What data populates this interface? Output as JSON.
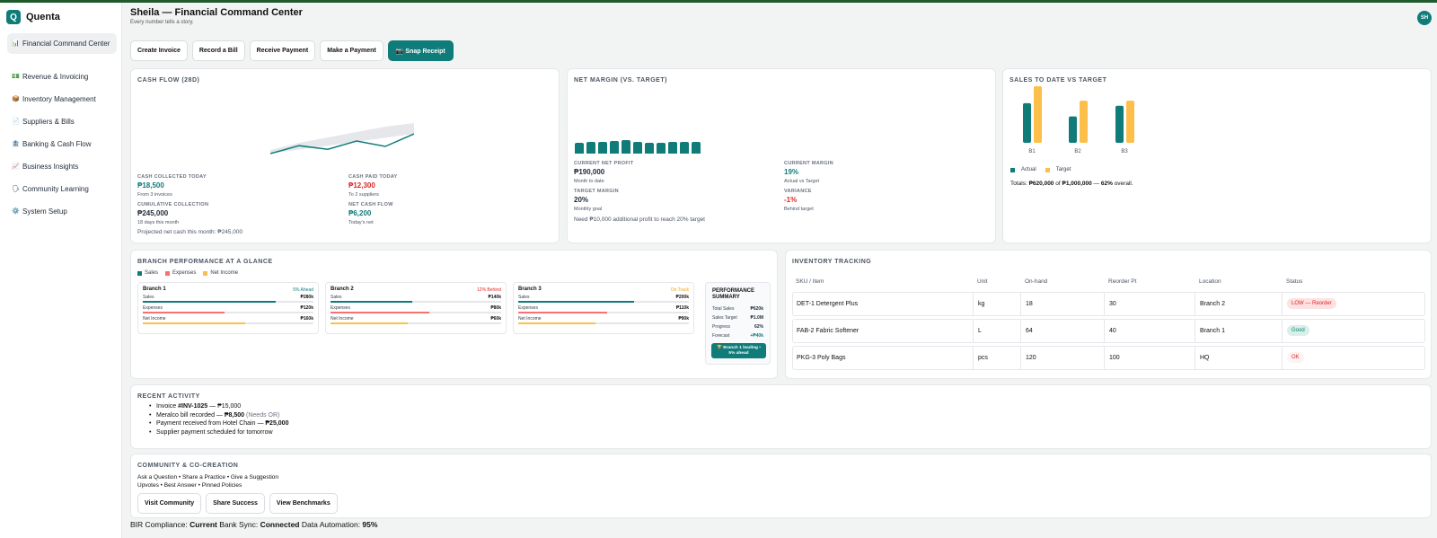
{
  "app": {
    "name": "Quenta",
    "logo_letter": "Q"
  },
  "sidebar": {
    "items": [
      {
        "icon": "📊",
        "label": "Financial Command Center",
        "active": true
      },
      {
        "icon": "💵",
        "label": "Revenue & Invoicing"
      },
      {
        "icon": "📦",
        "label": "Inventory Management"
      },
      {
        "icon": "📄",
        "label": "Suppliers & Bills"
      },
      {
        "icon": "🏦",
        "label": "Banking & Cash Flow"
      },
      {
        "icon": "📈",
        "label": "Business Insights"
      },
      {
        "icon": "🗣",
        "label": "Community Learning"
      },
      {
        "icon": "⚙️",
        "label": "System Setup"
      }
    ]
  },
  "header": {
    "title": "Sheila — Financial Command Center",
    "subtitle": "Every number tells a story.",
    "avatar": "SH"
  },
  "actions": {
    "create_invoice": "Create Invoice",
    "record_bill": "Record a Bill",
    "receive_payment": "Receive Payment",
    "make_payment": "Make a Payment",
    "snap_receipt": "📷 Snap Receipt"
  },
  "cashflow": {
    "title": "Cash Flow (28d)",
    "collected_label": "CASH COLLECTED TODAY",
    "collected_value": "₱18,500",
    "collected_sub": "From 3 invoices",
    "paid_label": "CASH PAID TODAY",
    "paid_value": "₱12,300",
    "paid_sub": "To 2 suppliers",
    "cumulative_label": "CUMULATIVE COLLECTION",
    "cumulative_value": "₱245,000",
    "cumulative_sub": "18 days this month",
    "net_label": "NET CASH FLOW",
    "net_value": "₱6,200",
    "net_sub": "Today's net",
    "projection": "Projected net cash this month: ₱245,000"
  },
  "net_margin": {
    "title": "Net Margin (vs. Target)",
    "bar_values": [
      0.55,
      0.6,
      0.6,
      0.65,
      0.68,
      0.6,
      0.55,
      0.55,
      0.58,
      0.58,
      0.58
    ],
    "profit_label": "CURRENT NET PROFIT",
    "profit_value": "₱190,000",
    "profit_sub": "Month to date",
    "margin_label": "CURRENT MARGIN",
    "margin_value": "19%",
    "margin_sub": "Actual vs Target",
    "target_label": "TARGET MARGIN",
    "target_value": "20%",
    "target_sub": "Monthly goal",
    "variance_label": "VARIANCE",
    "variance_value": "-1%",
    "variance_sub": "Behind target",
    "note": "Need ₱10,000 additional profit to reach 20% target"
  },
  "sales_target": {
    "title": "Sales to Date vs Target",
    "legend_actual": "Actual",
    "legend_target": "Target",
    "totals_prefix": "Totals: ",
    "totals_sales": "₱620,000",
    "totals_of": " of ",
    "totals_target": "₱1,000,000",
    "totals_dash": " — ",
    "totals_pct": "62%",
    "totals_suffix": " overall.",
    "colors": {
      "actual": "#0f7c7a",
      "target": "#fbbf4a"
    }
  },
  "chart_data": [
    {
      "type": "line",
      "series": [
        {
          "values": [
            0,
            0.22,
            0.12,
            0.35,
            0.2,
            0.55
          ]
        }
      ],
      "area": [
        0.1,
        0.3,
        0.45,
        0.6,
        0.75,
        0.85
      ]
    },
    {
      "type": "bar",
      "categories": [
        "B1",
        "B2",
        "B3"
      ],
      "series": [
        {
          "name": "Actual",
          "values": [
            0.63,
            0.42,
            0.59
          ]
        },
        {
          "name": "Target",
          "values": [
            0.9,
            0.67,
            0.67
          ]
        }
      ]
    }
  ],
  "branch_perf": {
    "title": "Branch Performance at a Glance",
    "legend": [
      "Sales",
      "Expenses",
      "Net Income"
    ],
    "branches": [
      {
        "name": "Branch 1",
        "status": "5% Ahead",
        "status_color": "#0f7c7a",
        "sales": "₱280k",
        "expenses": "₱120k",
        "net": "₱160k",
        "fills": [
          0.78,
          0.48,
          0.6
        ]
      },
      {
        "name": "Branch 2",
        "status": "12% Behind",
        "status_color": "#dc2626",
        "sales": "₱140k",
        "expenses": "₱80k",
        "net": "₱60k",
        "fills": [
          0.48,
          0.58,
          0.45
        ]
      },
      {
        "name": "Branch 3",
        "status": "On Track",
        "status_color": "#f59e0b",
        "sales": "₱200k",
        "expenses": "₱110k",
        "net": "₱90k",
        "fills": [
          0.68,
          0.52,
          0.45
        ]
      }
    ],
    "row_labels": {
      "sales": "Sales",
      "expenses": "Expenses",
      "net": "Net Income"
    },
    "summary": {
      "title": "PERFORMANCE SUMMARY",
      "total_sales_l": "Total Sales",
      "total_sales_v": "₱620k",
      "sales_target_l": "Sales Target",
      "sales_target_v": "₱1.0M",
      "progress_l": "Progress",
      "progress_v": "62%",
      "forecast_l": "Forecast",
      "forecast_v": "+₱40k",
      "callout": "🏆 Branch 1 leading • 5% ahead"
    }
  },
  "inventory": {
    "title": "Inventory Tracking",
    "columns": [
      "SKU / Item",
      "Unit",
      "On-hand",
      "Reorder Pt",
      "Location",
      "Status"
    ],
    "rows": [
      {
        "item": "DET-1 Detergent Plus",
        "unit": "kg",
        "onhand": "18",
        "reorder": "30",
        "location": "Branch 2",
        "status": "LOW — Reorder",
        "kind": "low"
      },
      {
        "item": "FAB-2 Fabric Softener",
        "unit": "L",
        "onhand": "64",
        "reorder": "40",
        "location": "Branch 1",
        "status": "Good",
        "kind": "good"
      },
      {
        "item": "PKG-3 Poly Bags",
        "unit": "pcs",
        "onhand": "120",
        "reorder": "100",
        "location": "HQ",
        "status": "OK",
        "kind": "ok"
      }
    ]
  },
  "activity": {
    "title": "Recent Activity",
    "items": [
      {
        "pre": "Invoice ",
        "bold": "#INV-1025",
        "post": " — ₱15,000",
        "muted": ""
      },
      {
        "pre": "Meralco bill recorded — ",
        "bold": "₱8,500",
        "post": " ",
        "muted": "(Needs OR)"
      },
      {
        "pre": "Payment received from Hotel Chain — ",
        "bold": "₱25,000",
        "post": "",
        "muted": ""
      },
      {
        "pre": "Supplier payment scheduled for tomorrow",
        "bold": "",
        "post": "",
        "muted": ""
      }
    ]
  },
  "community": {
    "title": "Community & Co-Creation",
    "line1": "Ask a Question • Share a Practice • Give a Suggestion",
    "line2": "Upvotes • Best Answer • Pinned Policies",
    "visit": "Visit Community",
    "share": "Share Success",
    "bench": "View Benchmarks"
  },
  "footer": {
    "bir_l": "BIR Compliance: ",
    "bir_v": "Current",
    "bank_l": " Bank Sync: ",
    "bank_v": "Connected",
    "auto_l": " Data Automation: ",
    "auto_v": "95%"
  }
}
